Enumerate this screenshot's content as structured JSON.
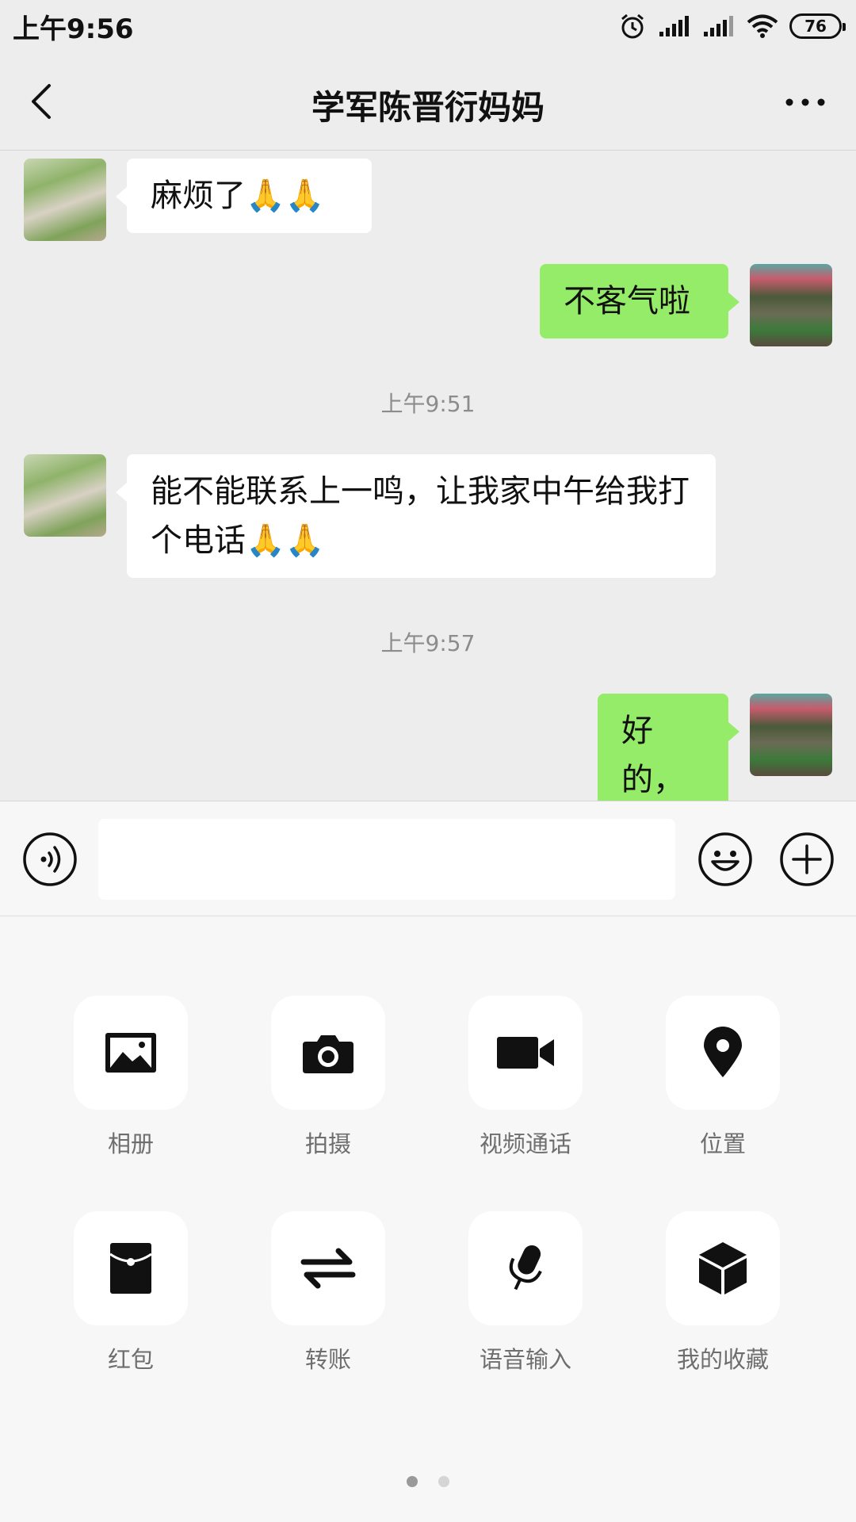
{
  "status_bar": {
    "time": "上午9:56",
    "battery": "76"
  },
  "nav": {
    "title": "学军陈晋衍妈妈"
  },
  "messages": [
    {
      "side": "left",
      "text": "麻烦了🙏🙏"
    },
    {
      "side": "right",
      "text": "不客气啦"
    },
    {
      "type": "time",
      "text": "上午9:51"
    },
    {
      "side": "left",
      "text": "能不能联系上一鸣，让我家中午给我打个电话🙏🙏"
    },
    {
      "type": "time",
      "text": "上午9:57"
    },
    {
      "side": "right",
      "text": "好的，"
    }
  ],
  "input": {
    "value": ""
  },
  "panel": {
    "items": [
      {
        "label": "相册",
        "icon": "album-icon"
      },
      {
        "label": "拍摄",
        "icon": "camera-icon"
      },
      {
        "label": "视频通话",
        "icon": "video-call-icon"
      },
      {
        "label": "位置",
        "icon": "location-icon"
      },
      {
        "label": "红包",
        "icon": "red-packet-icon"
      },
      {
        "label": "转账",
        "icon": "transfer-icon"
      },
      {
        "label": "语音输入",
        "icon": "voice-input-icon"
      },
      {
        "label": "我的收藏",
        "icon": "favorites-icon"
      }
    ],
    "page_count": 2,
    "current_page": 1
  },
  "colors": {
    "background": "#EDEDED",
    "bubble_self": "#95EC69",
    "bubble_other": "#FFFFFF",
    "panel": "#F7F7F7"
  }
}
